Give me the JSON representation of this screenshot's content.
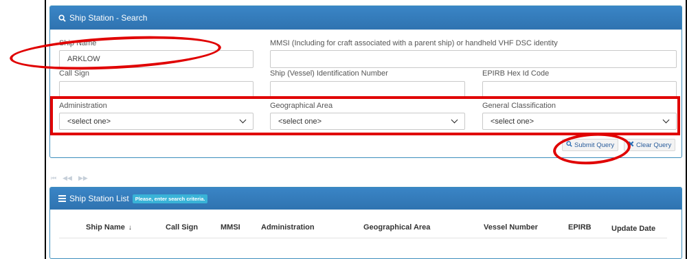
{
  "search_panel": {
    "title": "Ship Station - Search",
    "fields": {
      "ship_name": {
        "label": "Ship Name",
        "value": "ARKLOW"
      },
      "mmsi": {
        "label": "MMSI (Including for craft associated with a parent ship) or handheld VHF DSC identity",
        "value": ""
      },
      "call_sign": {
        "label": "Call Sign",
        "value": ""
      },
      "vessel_id": {
        "label": "Ship (Vessel) Identification Number",
        "value": ""
      },
      "epirb": {
        "label": "EPIRB Hex Id Code",
        "value": ""
      },
      "administration": {
        "label": "Administration",
        "selected": "<select one>"
      },
      "geo_area": {
        "label": "Geographical Area",
        "selected": "<select one>"
      },
      "general_class": {
        "label": "General Classification",
        "selected": "<select one>"
      }
    },
    "buttons": {
      "submit": "Submit Query",
      "clear": "Clear Query"
    }
  },
  "pager": {
    "first": "⏮",
    "prev": "◀◀",
    "next": "▶▶"
  },
  "list_panel": {
    "title": "Ship Station List",
    "badge": "Please, enter search criteria.",
    "columns": [
      "Ship Name",
      "Call Sign",
      "MMSI",
      "Administration",
      "Geographical Area",
      "Vessel Number",
      "EPIRB",
      "Update Date"
    ]
  },
  "colors": {
    "header_blue": "#337ab7",
    "annotation_red": "#e00000",
    "badge_cyan": "#39b3d7"
  }
}
